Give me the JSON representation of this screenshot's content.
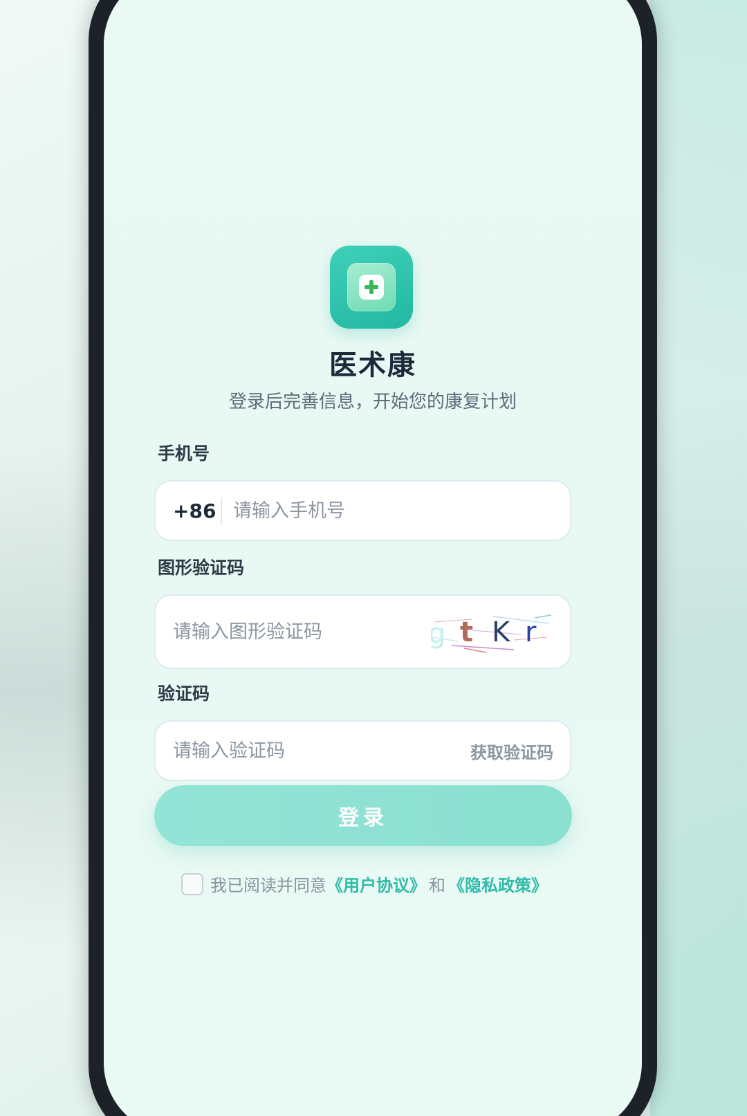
{
  "app": {
    "name": "医术康",
    "subtitle": "登录后完善信息，开始您的康复计划",
    "icon": "medical-cross-icon"
  },
  "form": {
    "phone": {
      "label": "手机号",
      "country_code": "+86",
      "placeholder": "请输入手机号",
      "value": ""
    },
    "captcha": {
      "label": "图形验证码",
      "placeholder": "请输入图形验证码",
      "value": "",
      "image_text": "gtKr"
    },
    "sms_code": {
      "label": "验证码",
      "placeholder": "请输入验证码",
      "value": "",
      "get_code_label": "获取验证码"
    }
  },
  "login_button": {
    "label": "登录"
  },
  "agreement": {
    "prefix": "我已阅读并同意",
    "user_agreement": "《用户协议》",
    "conjunction": "和",
    "privacy_policy": "《隐私政策》",
    "checked": false
  },
  "colors": {
    "accent": "#2fbba8",
    "button": "#8be0d0",
    "title": "#1b2a3a"
  }
}
